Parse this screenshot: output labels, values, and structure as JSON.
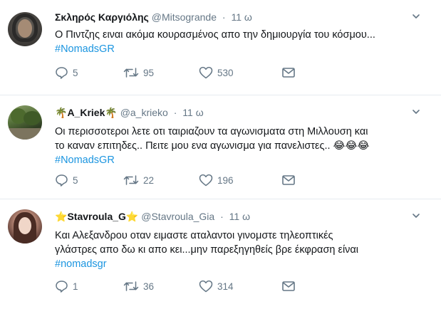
{
  "tweets": [
    {
      "name": "Σκληρός Καργιόλης",
      "handle": "@Mitsogrande",
      "time": "11 ω",
      "lines": [
        "Ο Πιντζης ειναι ακόμα κουρασμένος απο την δημιουργία του κόσμου..."
      ],
      "hashtag": "#NomadsGR",
      "replies": "5",
      "retweets": "95",
      "likes": "530"
    },
    {
      "name": "A_Kriek",
      "name_prefix": "🌴",
      "name_suffix": "🌴",
      "handle": "@a_krieko",
      "time": "11 ω",
      "lines": [
        "Οι περισσοτεροι λετε οτι ταιριαζουν τα αγωνισματα στη Μιλλουση και",
        "το καναν επιτηδες.. Πειτε μου ενα αγωνισμα για πανελιστες.. 😂😂😂"
      ],
      "hashtag": "#NomadsGR",
      "replies": "5",
      "retweets": "22",
      "likes": "196"
    },
    {
      "name": "Stavroula_G",
      "name_prefix": "⭐",
      "name_suffix": "⭐",
      "handle": "@Stavroula_Gia",
      "time": "11 ω",
      "lines": [
        "Και Αλεξανδρου οταν ειμαστε αταλαντοι γινομστε τηλεοπτικές",
        "γλάστρες απο δω κι απο κει...μην παρεξηγηθείς βρε έκφραση είναι"
      ],
      "hashtag": "#nomadsgr",
      "replies": "1",
      "retweets": "36",
      "likes": "314"
    }
  ],
  "icons": {
    "reply": "reply-icon",
    "retweet": "retweet-icon",
    "like": "heart-icon",
    "dm": "envelope-icon",
    "caret": "chevron-down-icon"
  },
  "colors": {
    "text": "#14171a",
    "muted": "#657786",
    "hashtag": "#1b95e0",
    "divider": "#e6ecf0"
  }
}
